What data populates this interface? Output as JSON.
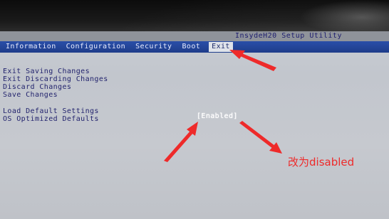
{
  "bios": {
    "title": "InsydeH20 Setup Utility",
    "tabs": [
      {
        "label": "Information"
      },
      {
        "label": "Configuration"
      },
      {
        "label": "Security"
      },
      {
        "label": "Boot"
      },
      {
        "label": "Exit",
        "selected": true
      }
    ],
    "exit_options": [
      {
        "label": "Exit Saving Changes"
      },
      {
        "label": "Exit Discarding Changes"
      },
      {
        "label": "Discard Changes"
      },
      {
        "label": "Save Changes"
      }
    ],
    "default_options": [
      {
        "label": "Load Default Settings"
      },
      {
        "label": "OS Optimized Defaults",
        "value": "[Enabled]"
      }
    ]
  },
  "annotation": {
    "text": "改为disabled",
    "color": "#ee2a2a"
  },
  "colors": {
    "menubar": "#1e3c8a",
    "screen": "#c6c9cf",
    "option_text": "#23246e",
    "value_text": "#ffffff"
  }
}
